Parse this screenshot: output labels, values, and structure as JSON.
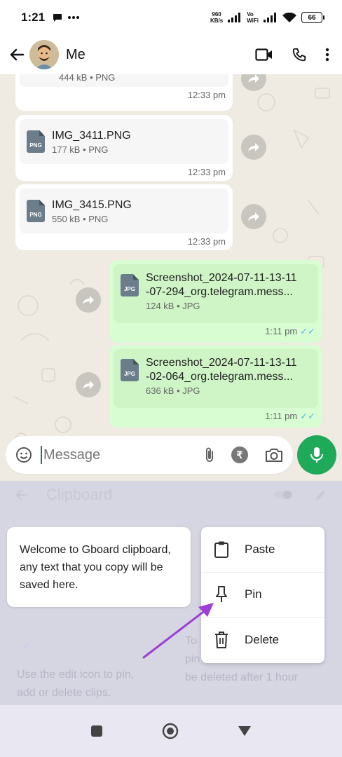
{
  "status_bar": {
    "time": "1:21",
    "net_speed_value": "960",
    "net_speed_unit": "KB/s",
    "vowifi_top": "Vo",
    "vowifi_bottom": "WiFi",
    "battery": "66"
  },
  "header": {
    "contact_name": "Me"
  },
  "messages": [
    {
      "direction": "in",
      "file_name": "",
      "meta": "444 kB • PNG",
      "type": "PNG",
      "time": "12:33 pm"
    },
    {
      "direction": "in",
      "file_name": "IMG_3411.PNG",
      "meta": "177 kB • PNG",
      "type": "PNG",
      "time": "12:33 pm"
    },
    {
      "direction": "in",
      "file_name": "IMG_3415.PNG",
      "meta": "550 kB • PNG",
      "type": "PNG",
      "time": "12:33 pm"
    },
    {
      "direction": "out",
      "file_name_line1": "Screenshot_2024-07-11-13-11",
      "file_name_line2": "-07-294_org.telegram.mess...",
      "meta": "124 kB • JPG",
      "type": "JPG",
      "time": "1:11 pm"
    },
    {
      "direction": "out",
      "file_name_line1": "Screenshot_2024-07-11-13-11",
      "file_name_line2": "-02-064_org.telegram.mess...",
      "meta": "636 kB • JPG",
      "type": "JPG",
      "time": "1:11 pm"
    }
  ],
  "input": {
    "placeholder": "Message",
    "rupee_symbol": "₹"
  },
  "clipboard": {
    "title": "Clipboard",
    "welcome_text": "Welcome to Gboard clipboard, any text that you copy will be saved here.",
    "faded_left_line1": "Use the edit icon to pin,",
    "faded_left_line2": "add or delete clips.",
    "faded_right_line1": "To",
    "faded_right_line2": "pin",
    "faded_right_line3": "be deleted after 1 hour"
  },
  "context_menu": {
    "items": [
      {
        "label": "Paste",
        "icon": "clipboard-icon"
      },
      {
        "label": "Pin",
        "icon": "pin-icon"
      },
      {
        "label": "Delete",
        "icon": "trash-icon"
      }
    ]
  },
  "colors": {
    "accent_green": "#1faa59",
    "outgoing_bubble": "#d9fdd3",
    "chat_background": "#efeae2",
    "read_ticks": "#53bdeb",
    "annotation_arrow": "#9b3fd6"
  }
}
